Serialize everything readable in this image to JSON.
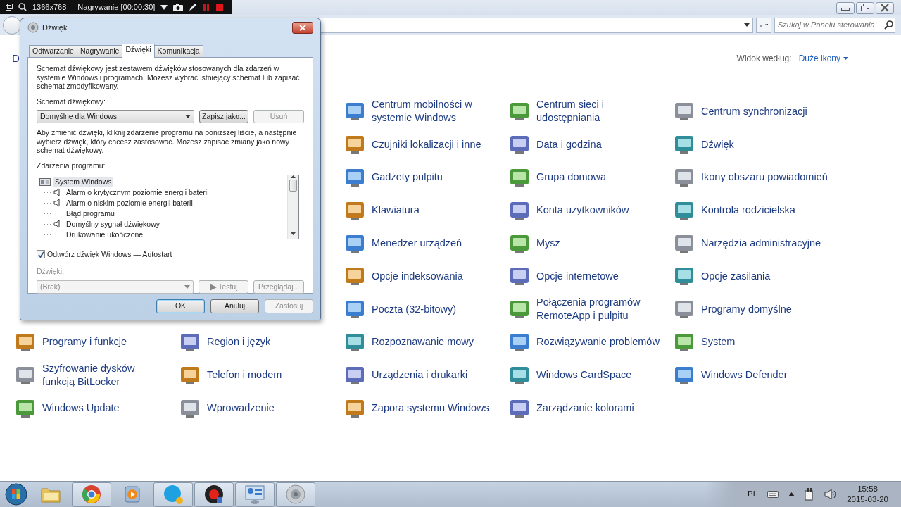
{
  "recorder_bar": {
    "resolution": "1366x768",
    "status": "Nagrywanie [00:00:30]"
  },
  "explorer": {
    "search": {
      "placeholder": "Szukaj w Panelu sterowania"
    },
    "heading": "D",
    "view_label": "Widok według:",
    "view_value": "Duże ikony",
    "rows": [
      {
        "items": [
          "Centrum mobilności w systemie Windows",
          "Centrum sieci i udostępniania",
          "Centrum synchronizacji"
        ]
      },
      {
        "items": [
          "Czujniki lokalizacji i inne",
          "Data i godzina",
          "Dźwięk"
        ]
      },
      {
        "items": [
          "Gadżety pulpitu",
          "Grupa domowa",
          "Ikony obszaru powiadomień"
        ]
      },
      {
        "items": [
          "Klawiatura",
          "Konta użytkowników",
          "Kontrola rodzicielska"
        ]
      },
      {
        "items": [
          "Menedżer urządzeń",
          "Mysz",
          "Narzędzia administracyjne"
        ]
      },
      {
        "items": [
          "Opcje indeksowania",
          "Opcje internetowe",
          "Opcje zasilania"
        ]
      },
      {
        "items": [
          "Poczta (32-bitowy)",
          "Połączenia programów RemoteApp i pulpitu",
          "Programy domyślne"
        ]
      },
      {
        "items": [
          "Programy i funkcje",
          "Region i język",
          "Rozpoznawanie mowy",
          "Rozwiązywanie problemów",
          "System"
        ]
      },
      {
        "items": [
          "Szyfrowanie dysków funkcją BitLocker",
          "Telefon i modem",
          "Urządzenia i drukarki",
          "Windows CardSpace",
          "Windows Defender"
        ]
      },
      {
        "items": [
          "Windows Update",
          "Wprowadzenie",
          "Zapora systemu Windows",
          "Zarządzanie kolorami"
        ]
      }
    ]
  },
  "dialog": {
    "title": "Dźwięk",
    "tabs": [
      {
        "label": "Odtwarzanie",
        "selected": false
      },
      {
        "label": "Nagrywanie",
        "selected": false
      },
      {
        "label": "Dźwięki",
        "selected": true
      },
      {
        "label": "Komunikacja",
        "selected": false
      }
    ],
    "intro": "Schemat dźwiękowy jest zestawem dźwięków stosowanych dla zdarzeń w systemie Windows i programach. Możesz wybrać istniejący schemat lub zapisać schemat zmodyfikowany.",
    "scheme_label": "Schemat dźwiękowy:",
    "scheme_value": "Domyślne dla Windows",
    "scheme_buttons": [
      {
        "label": "Zapisz jako...",
        "disabled": false
      },
      {
        "label": "Usuń",
        "disabled": true
      }
    ],
    "hint": "Aby zmienić dźwięki, kliknij zdarzenie programu na poniższej liście, a następnie wybierz dźwięk, który chcesz zastosować. Możesz zapisać zmiany jako nowy schemat dźwiękowy.",
    "events_label": "Zdarzenia programu:",
    "events": [
      {
        "label": "System Windows",
        "selected": true,
        "children": [
          {
            "label": "Alarm o krytycznym poziomie energii baterii",
            "has_sound": true,
            "selected": false
          },
          {
            "label": "Alarm o niskim poziomie energii baterii",
            "has_sound": true,
            "selected": false
          },
          {
            "label": "Błąd programu",
            "has_sound": false,
            "selected": false
          },
          {
            "label": "Domyślny sygnał dźwiękowy",
            "has_sound": true,
            "selected": false
          },
          {
            "label": "Drukowanie ukończone",
            "has_sound": false,
            "selected": false
          }
        ]
      }
    ],
    "startup": {
      "label": "Odtwórz dźwięk Windows — Autostart",
      "checked": true
    },
    "sounds_label": "Dźwięki:",
    "sounds_disabled": true,
    "sound_value": "(Brak)",
    "sound_buttons": [
      {
        "label": "Testuj",
        "disabled": true
      },
      {
        "label": "Przeglądaj...",
        "disabled": true
      }
    ],
    "footer_buttons": [
      {
        "label": "OK",
        "disabled": false,
        "default": true
      },
      {
        "label": "Anuluj",
        "disabled": false,
        "default": false
      },
      {
        "label": "Zastosuj",
        "disabled": true,
        "default": false
      }
    ]
  },
  "taskbar": {
    "apps": [
      {
        "kind": "folder",
        "running": false
      },
      {
        "kind": "browser",
        "running": true
      },
      {
        "kind": "player",
        "running": false
      },
      {
        "kind": "messenger",
        "running": true
      },
      {
        "kind": "recorder",
        "running": true
      },
      {
        "kind": "panel",
        "running": true
      },
      {
        "kind": "speaker",
        "running": true
      }
    ],
    "language": "PL",
    "time": "15:58",
    "date": "2015-03-20"
  }
}
